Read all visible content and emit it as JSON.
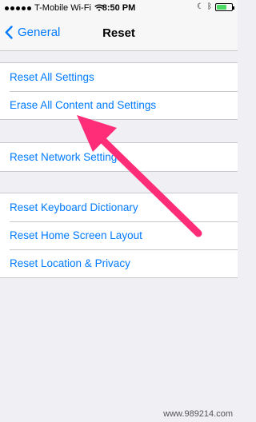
{
  "status_bar": {
    "carrier": "T-Mobile Wi-Fi",
    "time": "8:50 PM",
    "icons": [
      "signal-icon",
      "wifi-icon",
      "moon-icon",
      "bluetooth-icon",
      "battery-icon"
    ]
  },
  "nav": {
    "back_label": "General",
    "title": "Reset"
  },
  "groups": [
    {
      "items": [
        "Reset All Settings",
        "Erase All Content and Settings"
      ]
    },
    {
      "items": [
        "Reset Network Settings"
      ]
    },
    {
      "items": [
        "Reset Keyboard Dictionary",
        "Reset Home Screen Layout",
        "Reset Location & Privacy"
      ]
    }
  ],
  "colors": {
    "accent": "#007aff",
    "arrow": "#ff2d78",
    "background": "#efeff4"
  },
  "watermark": "www.989214.com"
}
